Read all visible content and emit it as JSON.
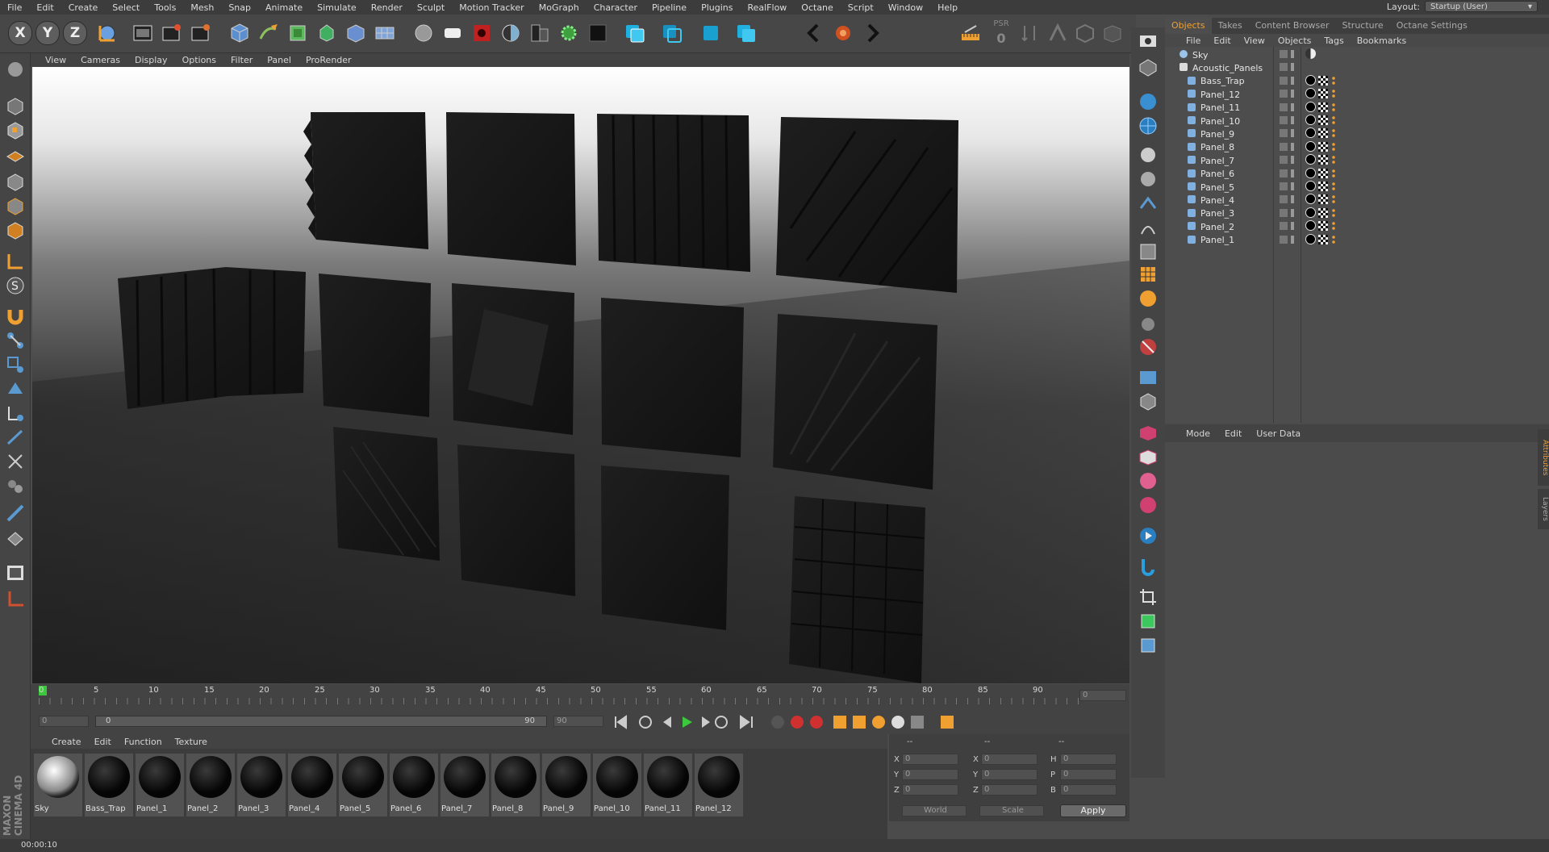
{
  "menu": [
    "File",
    "Edit",
    "Create",
    "Select",
    "Tools",
    "Mesh",
    "Snap",
    "Animate",
    "Simulate",
    "Render",
    "Sculpt",
    "Motion Tracker",
    "MoGraph",
    "Character",
    "Pipeline",
    "Plugins",
    "RealFlow",
    "Octane",
    "Script",
    "Window",
    "Help"
  ],
  "layout": {
    "label": "Layout:",
    "value": "Startup (User)"
  },
  "toolbar": {
    "x": "X",
    "y": "Y",
    "z": "Z",
    "psr": "PSR",
    "psr_value": "0"
  },
  "viewport": {
    "menu": [
      "View",
      "Cameras",
      "Display",
      "Options",
      "Filter",
      "Panel",
      "ProRender"
    ]
  },
  "timeline": {
    "ticks": [
      "0",
      "5",
      "10",
      "15",
      "20",
      "25",
      "30",
      "35",
      "40",
      "45",
      "50",
      "55",
      "60",
      "65",
      "70",
      "75",
      "80",
      "85",
      "90"
    ],
    "current_frame": "0",
    "start": "0",
    "range_start": "0",
    "range_end": "90",
    "end": "90"
  },
  "materials": {
    "menu": [
      "Create",
      "Edit",
      "Function",
      "Texture"
    ],
    "items": [
      "Sky",
      "Bass_Trap",
      "Panel_1",
      "Panel_2",
      "Panel_3",
      "Panel_4",
      "Panel_5",
      "Panel_6",
      "Panel_7",
      "Panel_8",
      "Panel_9",
      "Panel_10",
      "Panel_11",
      "Panel_12"
    ]
  },
  "coords": {
    "header": [
      "--",
      "--",
      "--"
    ],
    "rows": [
      {
        "a": "X",
        "av": "0",
        "b": "X",
        "bv": "0",
        "c": "H",
        "cv": "0"
      },
      {
        "a": "Y",
        "av": "0",
        "b": "Y",
        "bv": "0",
        "c": "P",
        "cv": "0"
      },
      {
        "a": "Z",
        "av": "0",
        "b": "Z",
        "bv": "0",
        "c": "B",
        "cv": "0"
      }
    ],
    "world": "World",
    "scale": "Scale",
    "apply": "Apply"
  },
  "status": {
    "time": "00:00:10"
  },
  "brand": {
    "maxon": "MAXON",
    "product": "CINEMA 4D"
  },
  "objects": {
    "tabs": [
      "Objects",
      "Takes",
      "Content Browser",
      "Structure",
      "Octane Settings"
    ],
    "menu": [
      "File",
      "Edit",
      "View",
      "Objects",
      "Tags",
      "Bookmarks"
    ],
    "tree": [
      {
        "name": "Sky",
        "level": 0
      },
      {
        "name": "Acoustic_Panels",
        "level": 0
      },
      {
        "name": "Bass_Trap",
        "level": 1
      },
      {
        "name": "Panel_12",
        "level": 1
      },
      {
        "name": "Panel_11",
        "level": 1
      },
      {
        "name": "Panel_10",
        "level": 1
      },
      {
        "name": "Panel_9",
        "level": 1
      },
      {
        "name": "Panel_8",
        "level": 1
      },
      {
        "name": "Panel_7",
        "level": 1
      },
      {
        "name": "Panel_6",
        "level": 1
      },
      {
        "name": "Panel_5",
        "level": 1
      },
      {
        "name": "Panel_4",
        "level": 1
      },
      {
        "name": "Panel_3",
        "level": 1
      },
      {
        "name": "Panel_2",
        "level": 1
      },
      {
        "name": "Panel_1",
        "level": 1
      }
    ]
  },
  "attributes": {
    "menu": [
      "Mode",
      "Edit",
      "User Data"
    ],
    "side_tabs": [
      "Attributes",
      "Layers"
    ]
  },
  "colors": {
    "accent": "#f0a030",
    "play": "#3cc83c",
    "keyframe_red": "#d03030"
  }
}
